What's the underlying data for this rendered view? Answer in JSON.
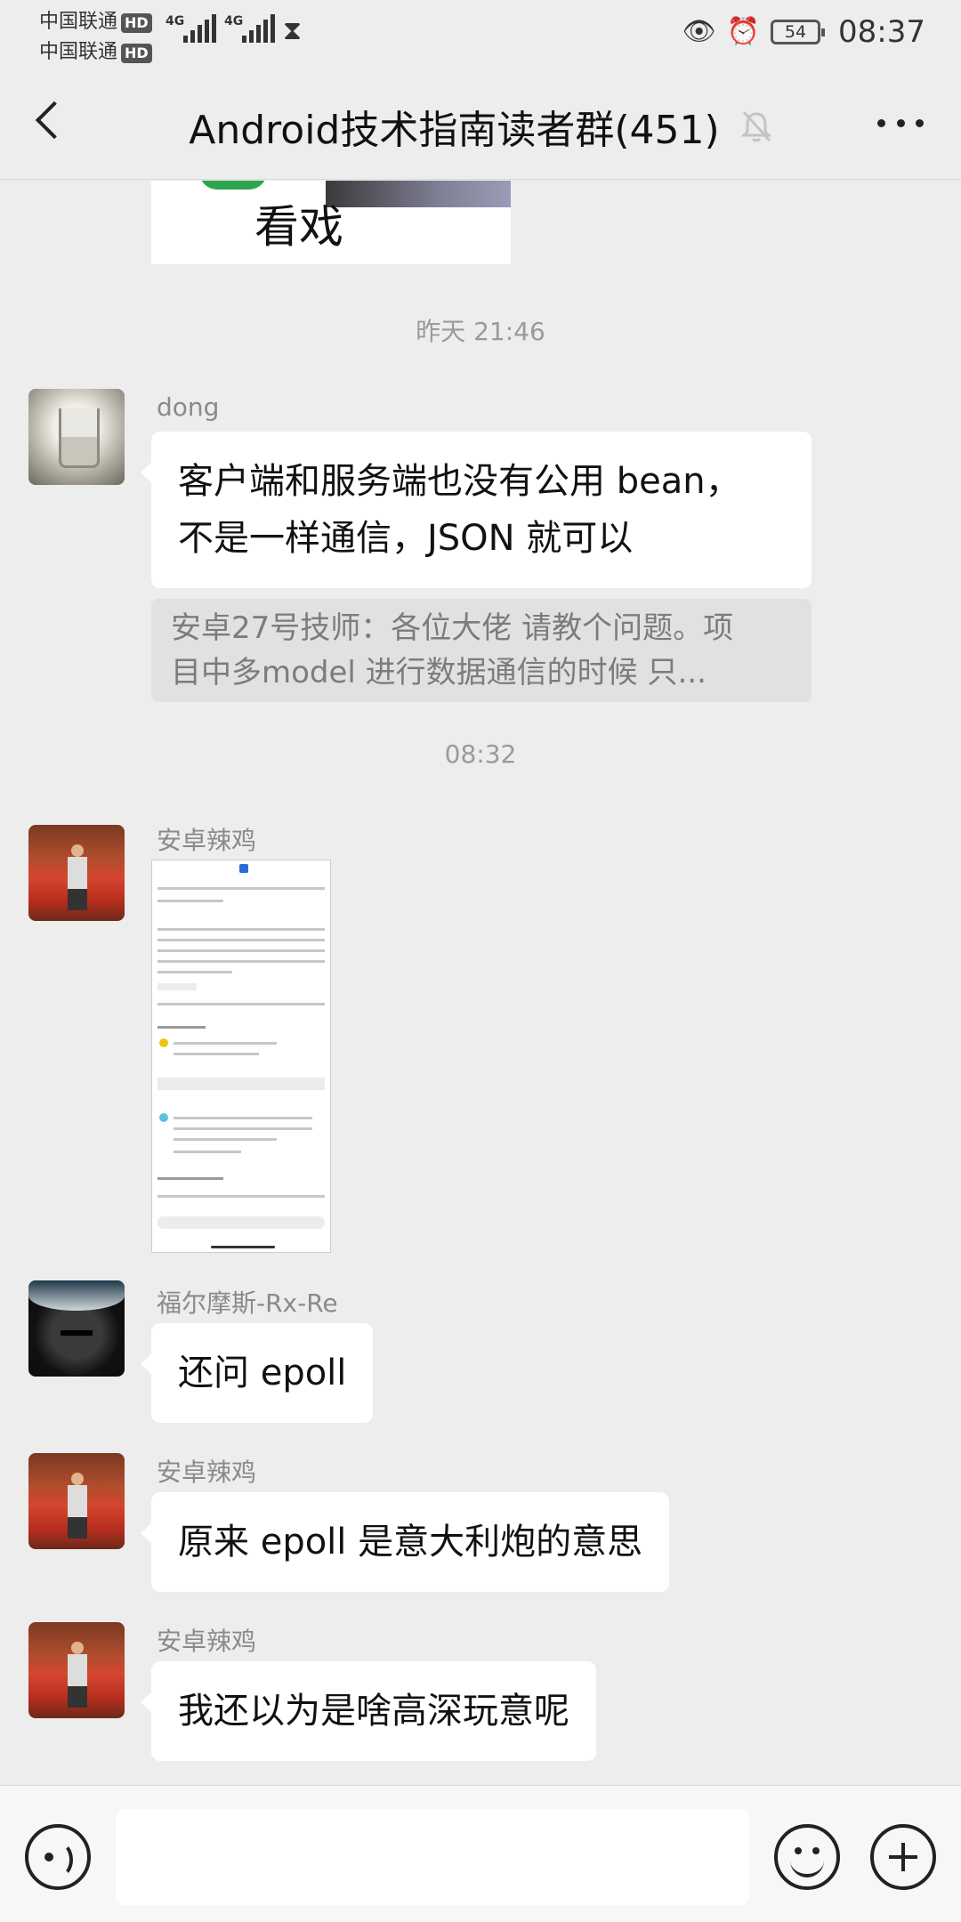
{
  "status_bar": {
    "carrier_1": "中国联通",
    "carrier_2": "中国联通",
    "hd_label": "HD",
    "network_1": "4G",
    "network_2": "4G",
    "battery": "54",
    "time": "08:37",
    "icons": [
      "hd-badge",
      "signal-bars",
      "hourglass-icon",
      "eye-icon",
      "alarm-icon",
      "battery-icon"
    ]
  },
  "header": {
    "title": "Android技术指南读者群(451)",
    "icons": [
      "back-arrow-icon",
      "mute-bell-icon",
      "more-dots-icon"
    ]
  },
  "messages": {
    "sticker_caption": "看戏",
    "timestamp_1": "昨天 21:46",
    "msg1": {
      "sender": "dong",
      "line1": "客户端和服务端也没有公用 bean，",
      "line2": "不是一样通信，JSON 就可以",
      "quote_line1": "安卓27号技师：各位大佬 请教个问题。项",
      "quote_line2": "目中多model 进行数据通信的时候 只..."
    },
    "timestamp_2": "08:32",
    "msg2": {
      "sender": "安卓辣鸡"
    },
    "msg3": {
      "sender": "福尔摩斯-Rx-Re",
      "text": "还问 epoll"
    },
    "msg4": {
      "sender": "安卓辣鸡",
      "text": "原来 epoll 是意大利炮的意思"
    },
    "msg5": {
      "sender": "安卓辣鸡",
      "text": "我还以为是啥高深玩意呢"
    }
  },
  "input_bar": {
    "placeholder": "",
    "icons": [
      "voice-icon",
      "emoji-icon",
      "plus-icon"
    ]
  }
}
